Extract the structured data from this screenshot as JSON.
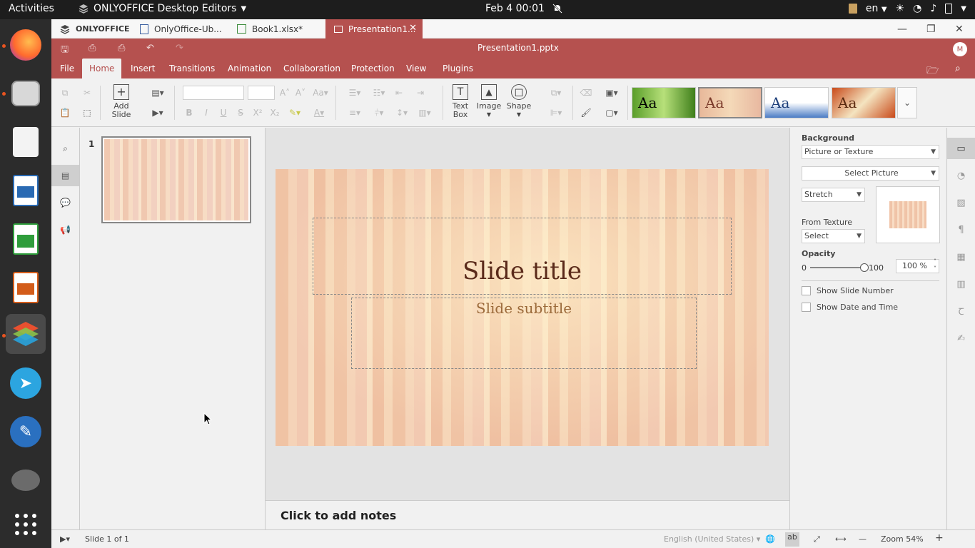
{
  "topbar": {
    "activities": "Activities",
    "app_name": "ONLYOFFICE Desktop Editors",
    "clock": "Feb 4  00:01",
    "lang": "en"
  },
  "tabs": [
    {
      "label": "ONLYOFFICE"
    },
    {
      "label": "OnlyOffice-Ub..."
    },
    {
      "label": "Book1.xlsx*"
    },
    {
      "label": "Presentation1..."
    }
  ],
  "titlebar": {
    "doc_title": "Presentation1.pptx",
    "avatar": "M"
  },
  "menu": {
    "items": [
      "File",
      "Home",
      "Insert",
      "Transitions",
      "Animation",
      "Collaboration",
      "Protection",
      "View",
      "Plugins"
    ],
    "active": "Home"
  },
  "toolbar": {
    "add_slide": "Add\nSlide",
    "add_slide_l1": "Add",
    "add_slide_l2": "Slide",
    "text_box_l1": "Text",
    "text_box_l2": "Box",
    "image": "Image",
    "shape": "Shape",
    "theme_label": "Aa"
  },
  "thumbnails": {
    "slide_number": "1"
  },
  "slide": {
    "title": "Slide title",
    "subtitle": "Slide subtitle"
  },
  "notes": {
    "placeholder": "Click to add notes"
  },
  "right_panel": {
    "background_label": "Background",
    "fill_type": "Picture or Texture",
    "select_picture": "Select Picture",
    "stretch": "Stretch",
    "from_texture_label": "From Texture",
    "texture_select": "Select",
    "opacity_label": "Opacity",
    "opacity_min": "0",
    "opacity_max": "100",
    "opacity_value": "100 %",
    "opacity": 1.0,
    "show_slide_number": "Show Slide Number",
    "show_date_time": "Show Date and Time"
  },
  "status": {
    "slide_of": "Slide 1 of 1",
    "language": "English (United States)",
    "zoom": "Zoom 54%"
  },
  "colors": {
    "accent": "#b5514f",
    "title_text": "#5a2a1a",
    "subtitle_text": "#9b6a3a"
  }
}
